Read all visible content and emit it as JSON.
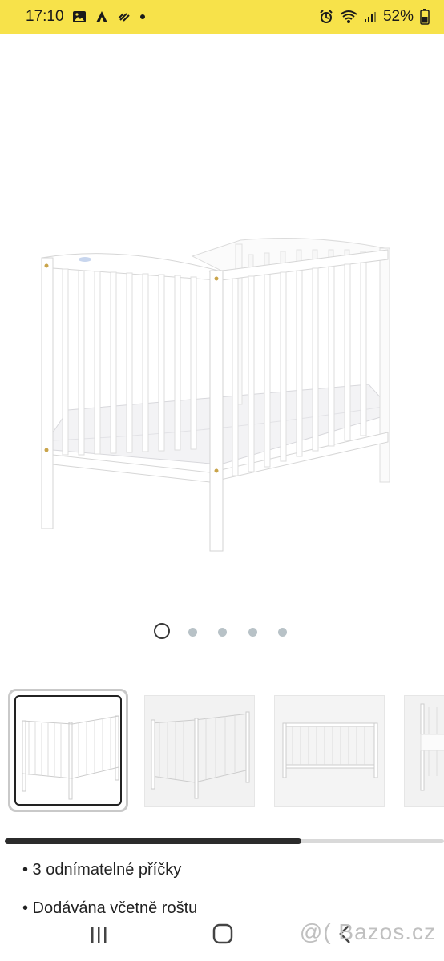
{
  "status_bar": {
    "time": "17:10",
    "battery": "52%",
    "background": "#f7e24a"
  },
  "icons": {
    "status_left": [
      "gallery-icon",
      "app-logo-icon",
      "missed-call-icon",
      "notification-dot-icon"
    ],
    "status_right": [
      "alarm-icon",
      "wifi-icon",
      "signal-icon",
      "battery-icon"
    ],
    "nav": [
      "recent-apps-icon",
      "home-icon",
      "back-icon"
    ]
  },
  "gallery": {
    "total_images": 5,
    "active_index": 0,
    "thumbnail_count_visible": 4,
    "scroll_progress": 0.68
  },
  "description": {
    "bullets": [
      "• 3 odnímatelné příčky",
      "• Dodávána včetně roštu"
    ]
  },
  "watermark": "@( Bazos.cz"
}
